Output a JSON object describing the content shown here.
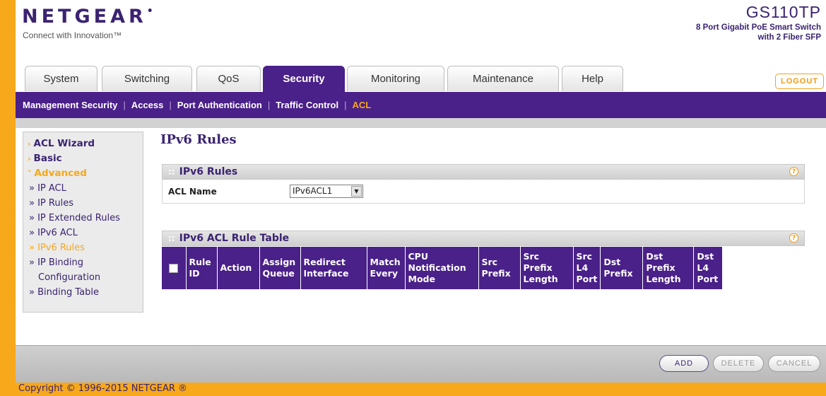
{
  "header": {
    "logo": "NETGEAR",
    "tagline": "Connect with Innovation™",
    "product_name": "GS110TP",
    "product_desc_line1": "8 Port Gigabit PoE Smart Switch",
    "product_desc_line2": "with 2 Fiber SFP",
    "logout_label": "LOGOUT"
  },
  "tabs": [
    {
      "label": "System"
    },
    {
      "label": "Switching"
    },
    {
      "label": "QoS"
    },
    {
      "label": "Security",
      "active": true
    },
    {
      "label": "Monitoring"
    },
    {
      "label": "Maintenance"
    },
    {
      "label": "Help"
    }
  ],
  "subnav": {
    "items": [
      "Management Security",
      "Access",
      "Port Authentication",
      "Traffic Control",
      "ACL"
    ],
    "separator": "|",
    "active": "ACL"
  },
  "sidebar": {
    "items": [
      {
        "label": "ACL Wizard",
        "icon": "chevron-right-icon"
      },
      {
        "label": "Basic",
        "icon": "chevron-right-icon"
      },
      {
        "label": "Advanced",
        "icon": "chevron-down-icon",
        "open": true
      }
    ],
    "subitems": [
      {
        "label": "» IP ACL"
      },
      {
        "label": "» IP Rules"
      },
      {
        "label": "» IP Extended Rules"
      },
      {
        "label": "» IPv6 ACL"
      },
      {
        "label": "» IPv6 Rules",
        "active": true
      },
      {
        "label": "» IP Binding"
      },
      {
        "label": "Configuration"
      },
      {
        "label": "» Binding Table"
      }
    ]
  },
  "main": {
    "page_title": "IPv6 Rules",
    "section1_title": "IPv6 Rules",
    "acl_name_label": "ACL Name",
    "acl_name_value": "IPv6ACL1",
    "section2_title": "IPv6 ACL Rule Table",
    "table_headers": [
      [
        "Rule",
        "ID"
      ],
      [
        "Action"
      ],
      [
        "Assign",
        "Queue"
      ],
      [
        "Redirect",
        "Interface"
      ],
      [
        "Match",
        "Every"
      ],
      [
        "CPU",
        "Notification",
        "Mode"
      ],
      [
        "Src",
        "Prefix"
      ],
      [
        "Src",
        "Prefix",
        "Length"
      ],
      [
        "Src",
        "L4",
        "Port"
      ],
      [
        "Dst",
        "Prefix"
      ],
      [
        "Dst",
        "Prefix",
        "Length"
      ],
      [
        "Dst",
        "L4",
        "Port"
      ]
    ]
  },
  "footer": {
    "add_label": "ADD",
    "delete_label": "DELETE",
    "cancel_label": "CANCEL",
    "copyright": "Copyright © 1996-2015 NETGEAR ®"
  },
  "colors": {
    "brand_purple": "#4a2089",
    "accent_orange": "#f7a81b"
  }
}
